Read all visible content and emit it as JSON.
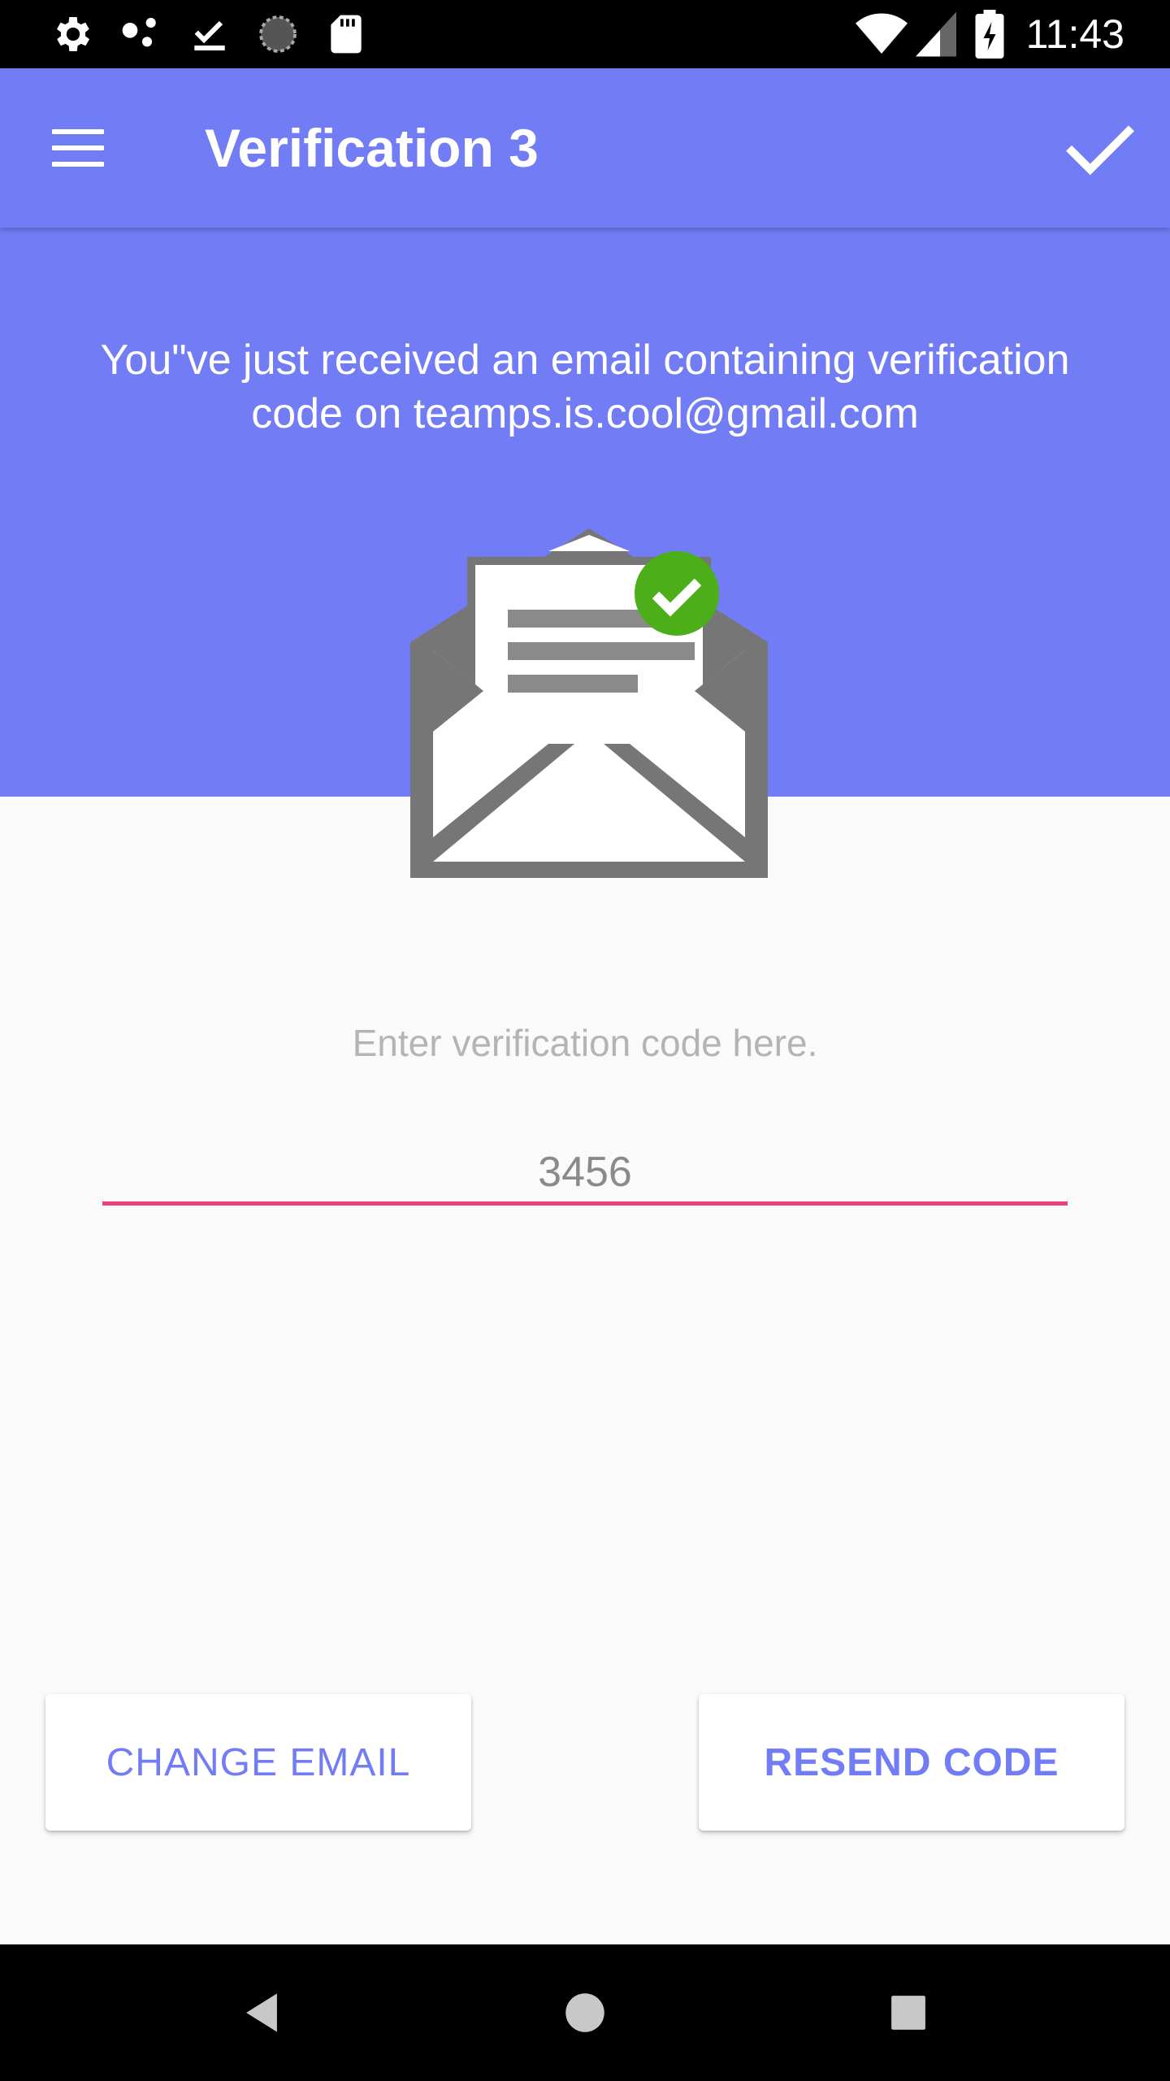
{
  "status_bar": {
    "time": "11:43",
    "left_icons": [
      "settings-icon",
      "connections-icon",
      "download-done-icon",
      "loading-icon",
      "sd-card-icon"
    ],
    "right_icons": [
      "wifi-icon",
      "signal-icon",
      "battery-charging-icon"
    ]
  },
  "app_bar": {
    "title": "Verification 3",
    "menu_icon": "menu-icon",
    "action_icon": "check-icon",
    "color": "#727cf5"
  },
  "header": {
    "message": "You\"ve just received an email containing verification code on teamps.is.cool@gmail.com"
  },
  "illustration": {
    "icon": "mail-opened-check-icon",
    "badge_color": "#4caf1a"
  },
  "verification": {
    "hint": "Enter verification code here.",
    "code_value": "3456",
    "underline_color": "#ec407a"
  },
  "buttons": {
    "change_email": "CHANGE EMAIL",
    "resend_code": "RESEND CODE"
  },
  "nav_bar": {
    "icons": [
      "back-icon",
      "home-icon",
      "recents-icon"
    ]
  }
}
